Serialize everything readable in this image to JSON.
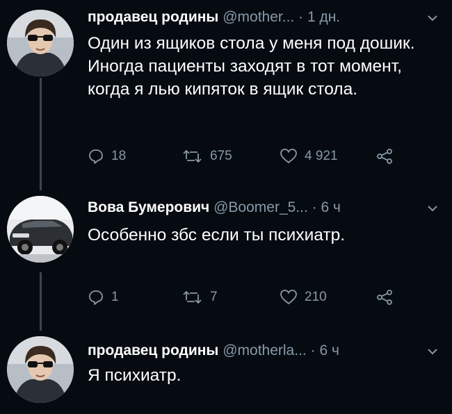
{
  "tweets": [
    {
      "author": "продавец родины",
      "handle": "@mother...",
      "dot": "·",
      "time": "1 дн.",
      "text": "Один из ящиков стола у меня под дошик. Иногда пациенты заходят в тот момент, когда я лью кипяток в ящик стола.",
      "replies": "18",
      "retweets": "675",
      "likes": "4 921"
    },
    {
      "author": "Вова Бумерович",
      "handle": "@Boomer_5...",
      "dot": "·",
      "time": "6 ч",
      "text": "Особенно збс если ты психиатр.",
      "replies": "1",
      "retweets": "7",
      "likes": "210"
    },
    {
      "author": "продавец родины",
      "handle": "@motherla...",
      "dot": "·",
      "time": "6 ч",
      "text": "Я психиатр."
    }
  ],
  "icons": {
    "reply": "reply-icon",
    "retweet": "retweet-icon",
    "like": "heart-icon",
    "share": "share-icon",
    "menu": "chevron-down-icon"
  },
  "colors": {
    "background": "#060b12",
    "muted": "#8899a6",
    "text": "#ffffff",
    "thread_line": "#3d4650"
  }
}
